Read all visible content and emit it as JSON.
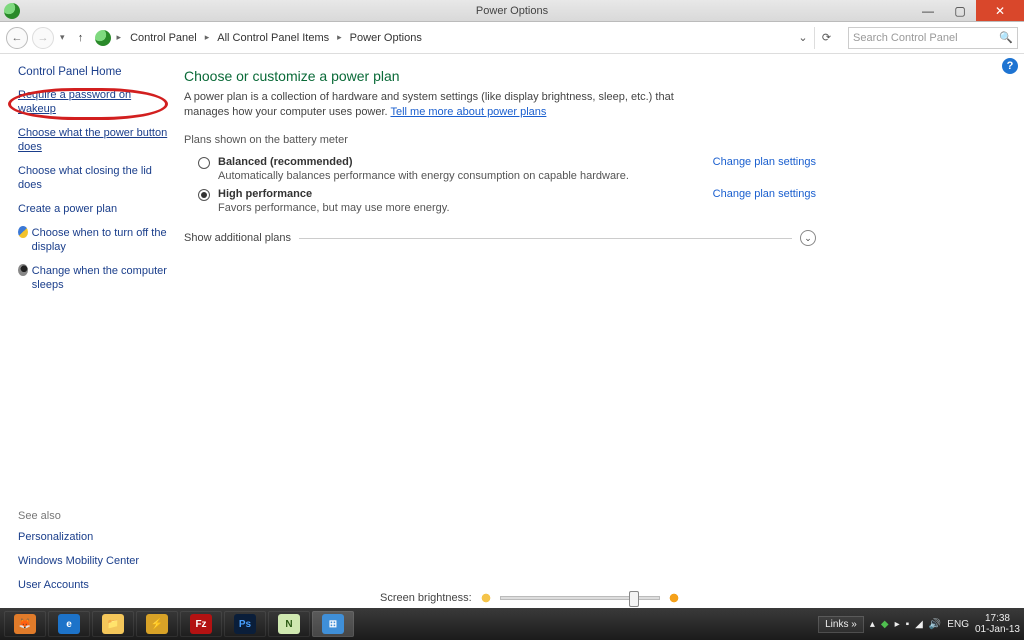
{
  "window": {
    "title": "Power Options"
  },
  "breadcrumb": {
    "root": "Control Panel",
    "mid": "All Control Panel Items",
    "leaf": "Power Options"
  },
  "search": {
    "placeholder": "Search Control Panel"
  },
  "sidebar": {
    "home": "Control Panel Home",
    "links": [
      "Require a password on wakeup",
      "Choose what the power button does",
      "Choose what closing the lid does",
      "Create a power plan",
      "Choose when to turn off the display",
      "Change when the computer sleeps"
    ],
    "seealso_hdr": "See also",
    "seealso": [
      "Personalization",
      "Windows Mobility Center",
      "User Accounts"
    ]
  },
  "main": {
    "heading": "Choose or customize a power plan",
    "desc1": "A power plan is a collection of hardware and system settings (like display brightness, sleep, etc.) that manages how your computer uses power. ",
    "desc_link": "Tell me more about power plans",
    "plans_header": "Plans shown on the battery meter",
    "plans": [
      {
        "name": "Balanced (recommended)",
        "sub": "Automatically balances performance with energy consumption on capable hardware.",
        "link": "Change plan settings",
        "selected": false
      },
      {
        "name": "High performance",
        "sub": "Favors performance, but may use more energy.",
        "link": "Change plan settings",
        "selected": true
      }
    ],
    "expander": "Show additional plans"
  },
  "brightness": {
    "label": "Screen brightness:"
  },
  "taskbar": {
    "apps": [
      "firefox",
      "ie",
      "explorer",
      "winamp",
      "filezilla",
      "photoshop",
      "notepadpp",
      "controlpanel"
    ],
    "links_label": "Links",
    "lang": "ENG",
    "time": "17:38",
    "date": "01-Jan-13"
  }
}
